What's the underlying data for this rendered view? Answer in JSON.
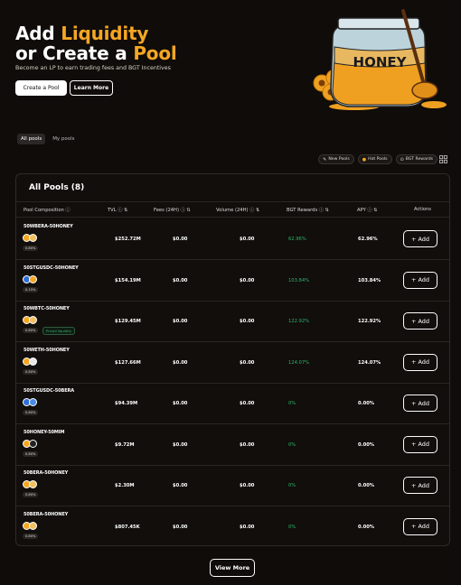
{
  "hero": {
    "title_line1_a": "Add ",
    "title_line1_b": "Liquidity",
    "title_line2_a": "or Create a ",
    "title_line2_b": "Pool",
    "subtitle": "Become an LP to earn trading fees and BGT Incentives",
    "create_pool_label": "Create a Pool",
    "learn_more_label": "Learn More",
    "illustration_text": "HONEY"
  },
  "tabs": [
    {
      "label": "All pools"
    },
    {
      "label": "My pools"
    }
  ],
  "filters": [
    {
      "label": "New Pools"
    },
    {
      "label": "Hot Pools"
    },
    {
      "label": "BGT Rewards"
    }
  ],
  "panel": {
    "title": "All Pools (8)",
    "columns": {
      "composition": "Pool Composition",
      "tvl": "TVL",
      "fees": "Fees (24H)",
      "volume": "Volume (24H)",
      "bgt": "BGT Rewards",
      "apy": "APY",
      "actions": "Actions"
    },
    "add_label": "+ Add",
    "priced_label": "Priced liquidity",
    "rows": [
      {
        "name": "50WBERA-50HONEY",
        "fee": "0.80%",
        "tvl": "$252.72M",
        "fees": "$0.00",
        "volume": "$0.00",
        "bgt": "62.96%",
        "apy": "62.96%"
      },
      {
        "name": "50STGUSDC-50HONEY",
        "fee": "0.15%",
        "tvl": "$154.19M",
        "fees": "$0.00",
        "volume": "$0.00",
        "bgt": "103.84%",
        "apy": "103.84%"
      },
      {
        "name": "50WBTC-50HONEY",
        "fee": "0.80%",
        "tvl": "$129.45M",
        "fees": "$0.00",
        "volume": "$0.00",
        "bgt": "122.92%",
        "apy": "122.92%"
      },
      {
        "name": "50WETH-50HONEY",
        "fee": "0.80%",
        "tvl": "$127.66M",
        "fees": "$0.00",
        "volume": "$0.00",
        "bgt": "124.07%",
        "apy": "124.07%"
      },
      {
        "name": "50STGUSDC-50BERA",
        "fee": "0.80%",
        "tvl": "$94.39M",
        "fees": "$0.00",
        "volume": "$0.00",
        "bgt": "0%",
        "apy": "0.00%"
      },
      {
        "name": "50HONEY-50MIM",
        "fee": "0.80%",
        "tvl": "$9.72M",
        "fees": "$0.00",
        "volume": "$0.00",
        "bgt": "0%",
        "apy": "0.00%"
      },
      {
        "name": "50BERA-50HONEY",
        "fee": "0.80%",
        "tvl": "$2.30M",
        "fees": "$0.00",
        "volume": "$0.00",
        "bgt": "0%",
        "apy": "0.00%"
      },
      {
        "name": "50BERA-50HONEY",
        "fee": "0.80%",
        "tvl": "$807.45K",
        "fees": "$0.00",
        "volume": "$0.00",
        "bgt": "0%",
        "apy": "0.00%"
      }
    ]
  },
  "view_more_label": "View More",
  "colors": {
    "accent": "#f5a623",
    "positive": "#2fb36b",
    "background": "#0f0c09"
  }
}
